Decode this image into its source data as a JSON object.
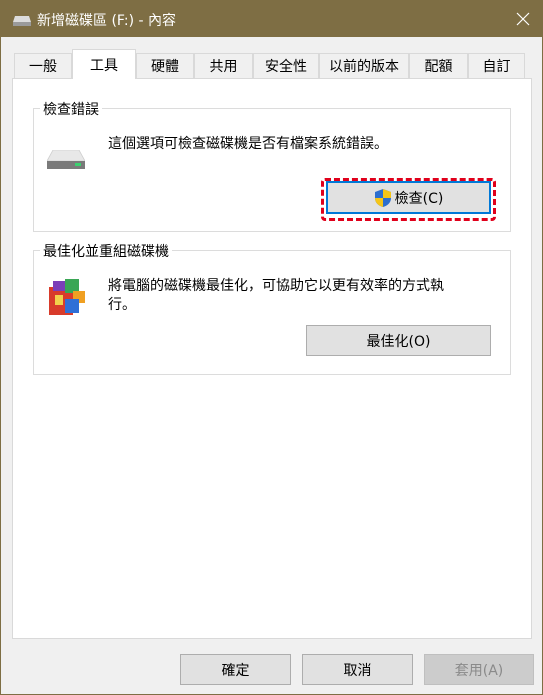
{
  "window": {
    "title": "新增磁碟區 (F:) - 內容"
  },
  "tabs": [
    {
      "label": "一般"
    },
    {
      "label": "工具"
    },
    {
      "label": "硬體"
    },
    {
      "label": "共用"
    },
    {
      "label": "安全性"
    },
    {
      "label": "以前的版本"
    },
    {
      "label": "配額"
    },
    {
      "label": "自訂"
    }
  ],
  "active_tab": "工具",
  "error_check": {
    "heading": "檢查錯誤",
    "description": "這個選項可檢查磁碟機是否有檔案系統錯誤。",
    "button_label": "檢查(C)"
  },
  "optimize": {
    "heading": "最佳化並重組磁碟機",
    "description_line1": "將電腦的磁碟機最佳化，可協助它以更有效率的方式執",
    "description_line2": "行。",
    "button_label": "最佳化(O)"
  },
  "footer": {
    "ok_label": "確定",
    "cancel_label": "取消",
    "apply_label": "套用(A)"
  },
  "colors": {
    "titlebar": "#7e6e44",
    "highlight": "#e0001b",
    "focus": "#0078d7"
  }
}
